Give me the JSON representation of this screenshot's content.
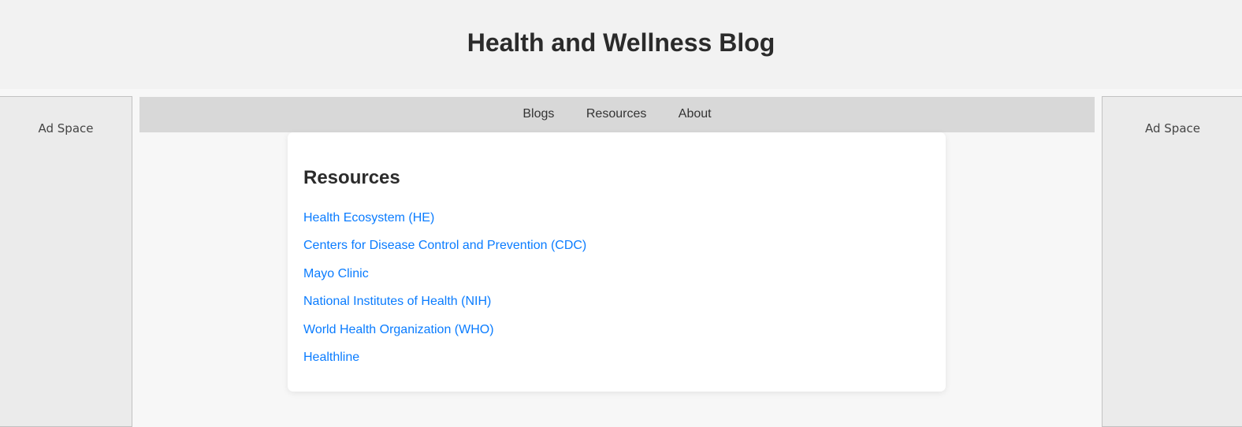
{
  "header": {
    "title": "Health and Wellness Blog"
  },
  "ads": {
    "left": "Ad Space",
    "right": "Ad Space"
  },
  "nav": {
    "items": [
      {
        "label": "Blogs"
      },
      {
        "label": "Resources"
      },
      {
        "label": "About"
      }
    ]
  },
  "resources": {
    "heading": "Resources",
    "links": [
      {
        "label": "Health Ecosystem (HE)"
      },
      {
        "label": "Centers for Disease Control and Prevention (CDC)"
      },
      {
        "label": "Mayo Clinic"
      },
      {
        "label": "National Institutes of Health (NIH)"
      },
      {
        "label": "World Health Organization (WHO)"
      },
      {
        "label": "Healthline"
      }
    ]
  },
  "colors": {
    "link": "#0a7cff",
    "nav_bg": "#d8d8d8",
    "header_bg": "#f2f2f2"
  }
}
